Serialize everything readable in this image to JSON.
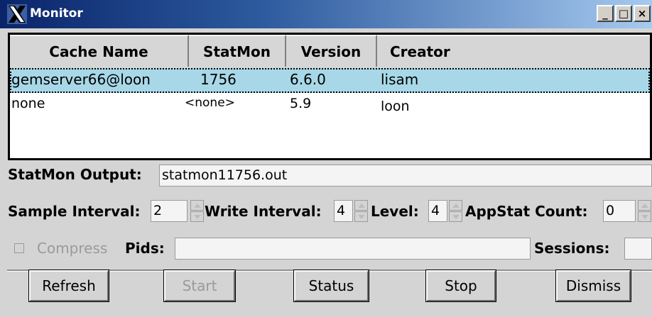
{
  "window": {
    "title": "Monitor",
    "controls": [
      "_",
      "□",
      "×"
    ]
  },
  "table": {
    "columns": [
      "Cache Name",
      "StatMon",
      "Version",
      "Creator"
    ],
    "rows": [
      {
        "cache_name": "gemserver66@loon",
        "statmon": "1756",
        "version": "6.6.0",
        "creator": "lisam",
        "selected": true
      },
      {
        "cache_name": "none",
        "statmon": "<none>",
        "version": "5.9",
        "creator": "loon",
        "selected": false
      }
    ]
  },
  "form": {
    "statmon_output": {
      "label": "StatMon Output:",
      "value": "statmon11756.out"
    },
    "sample_interval": {
      "label": "Sample Interval:",
      "value": "2"
    },
    "write_interval": {
      "label": "Write Interval:",
      "value": "4"
    },
    "level": {
      "label": "Level:",
      "value": "4"
    },
    "appstat_count": {
      "label": "AppStat Count:",
      "value": "0"
    },
    "compress": {
      "label": "Compress",
      "checked": false,
      "enabled": false
    },
    "pids": {
      "label": "Pids:",
      "value": ""
    },
    "sessions": {
      "label": "Sessions:",
      "value": ""
    }
  },
  "buttons": {
    "refresh": "Refresh",
    "start": "Start",
    "status": "Status",
    "stop": "Stop",
    "dismiss": "Dismiss"
  },
  "colors": {
    "title_bar": "#0a246a",
    "selected_row": "#a8d8e8",
    "background": "#d4d4d4"
  }
}
